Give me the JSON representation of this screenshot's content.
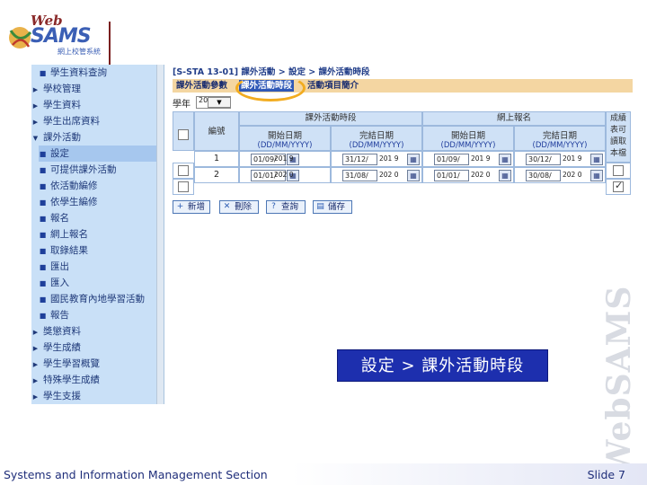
{
  "logo": {
    "web": "Web",
    "sams": "SAMS",
    "caption": "網上校管系統"
  },
  "sidebar": {
    "items": [
      {
        "label": "學生資料查詢",
        "marker": "■",
        "sub": true
      },
      {
        "label": "學校管理",
        "marker": "▶",
        "sub": false
      },
      {
        "label": "學生資料",
        "marker": "▶",
        "sub": false
      },
      {
        "label": "學生出席資料",
        "marker": "▶",
        "sub": false
      },
      {
        "label": "課外活動",
        "marker": "▼",
        "sub": false
      },
      {
        "label": "設定",
        "marker": "■",
        "sub": true,
        "selected": true
      },
      {
        "label": "可提供課外活動",
        "marker": "■",
        "sub": true
      },
      {
        "label": "依活動編修",
        "marker": "■",
        "sub": true
      },
      {
        "label": "依學生編修",
        "marker": "■",
        "sub": true
      },
      {
        "label": "報名",
        "marker": "■",
        "sub": true
      },
      {
        "label": "網上報名",
        "marker": "■",
        "sub": true
      },
      {
        "label": "取錄結果",
        "marker": "■",
        "sub": true
      },
      {
        "label": "匯出",
        "marker": "■",
        "sub": true
      },
      {
        "label": "匯入",
        "marker": "■",
        "sub": true
      },
      {
        "label": "國民教育內地學習活動",
        "marker": "■",
        "sub": true
      },
      {
        "label": "報告",
        "marker": "■",
        "sub": true
      },
      {
        "label": "獎懲資料",
        "marker": "▶",
        "sub": false
      },
      {
        "label": "學生成績",
        "marker": "▶",
        "sub": false
      },
      {
        "label": "學生學習概覽",
        "marker": "▶",
        "sub": false
      },
      {
        "label": "特殊學生成績",
        "marker": "▶",
        "sub": false
      },
      {
        "label": "學生支援",
        "marker": "▶",
        "sub": false
      }
    ]
  },
  "main": {
    "breadcrumb": "[S-STA 13-01] 課外活動 > 設定 > 課外活動時段",
    "tabs": [
      "課外活動參數",
      "課外活動時段",
      "活動項目簡介"
    ],
    "year_label": "學年",
    "year_value": "201 9",
    "year_select": "▼",
    "header": {
      "period_group": "課外活動時段",
      "online_group": "網上報名",
      "no": "編號",
      "start": "開始日期",
      "end": "完結日期",
      "date_fmt_1": "(DD/MM/YYYY)",
      "date_fmt_2": "(DD/MM/YYYY)",
      "date_fmt_3": "(DD/MM/YYYY)",
      "date_fmt_4": "(DD/MM/YYYY)",
      "result": "成績表可讀取本檔"
    },
    "rows": [
      {
        "no": "1",
        "start": "01/09/",
        "end": "31/12/",
        "ostart": "01/09/",
        "oend": "30/12/",
        "tip1": "201 9",
        "tip2": "201 9",
        "tip3": "201 9",
        "tip4": "201 9",
        "checked": false
      },
      {
        "no": "2",
        "start": "01/01/",
        "end": "31/08/",
        "ostart": "01/01/",
        "oend": "30/08/",
        "tip1": "202 0",
        "tip2": "202 0",
        "tip3": "202 0",
        "tip4": "202 0",
        "checked": true
      }
    ],
    "calendar_icon": "▦",
    "buttons": [
      {
        "label": "新增",
        "icon": "+"
      },
      {
        "label": "刪除",
        "icon": "✕"
      },
      {
        "label": "查詢",
        "icon": "?"
      },
      {
        "label": "儲存",
        "icon": "▤"
      }
    ]
  },
  "callout": "設定 > 課外活動時段",
  "watermark": "WebSAMS",
  "footer": {
    "left": "Systems and Information Management Section",
    "right": "Slide 7"
  },
  "colors": {
    "sidebar": "#c9e0f7",
    "tab_bar": "#f4d6a2",
    "active_tab": "#2f58b7",
    "ring": "#f2ac20",
    "callout": "#1d2fae"
  }
}
